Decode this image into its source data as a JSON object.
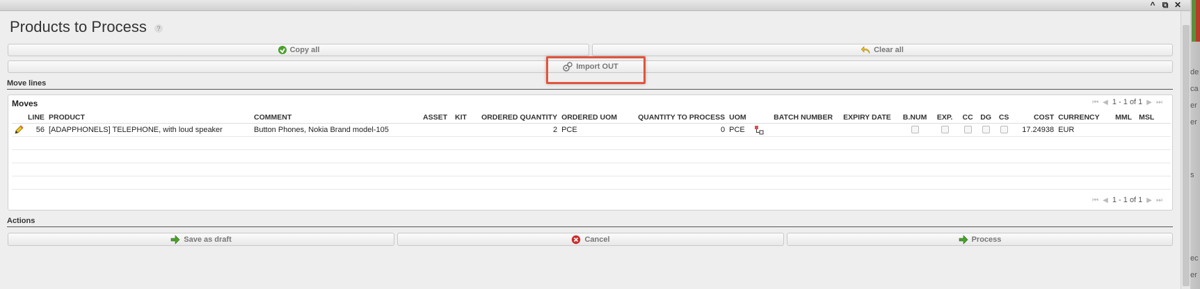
{
  "window": {
    "controls": [
      {
        "name": "minimize",
        "glyph": "^"
      },
      {
        "name": "popout",
        "glyph": "⧉"
      },
      {
        "name": "close",
        "glyph": "✕"
      }
    ]
  },
  "page": {
    "title": "Products to Process",
    "help_glyph": "?"
  },
  "toolbar": {
    "copy_all_label": "Copy all",
    "clear_all_label": "Clear all",
    "import_out_label": "Import OUT"
  },
  "sections": {
    "move_lines": "Move lines",
    "actions": "Actions"
  },
  "grid": {
    "title": "Moves",
    "pager_info": "1 - 1 of 1",
    "columns": {
      "line": "LINE",
      "product": "PRODUCT",
      "comment": "COMMENT",
      "asset": "ASSET",
      "kit": "KIT",
      "ordered_quantity": "ORDERED QUANTITY",
      "ordered_uom": "ORDERED UOM",
      "quantity_to_process": "QUANTITY TO PROCESS",
      "uom": "UOM",
      "batch_number": "BATCH NUMBER",
      "expiry_date": "EXPIRY DATE",
      "bnum": "B.NUM",
      "exp": "EXP.",
      "cc": "CC",
      "dg": "DG",
      "cs": "CS",
      "cost": "COST",
      "currency": "CURRENCY",
      "mml": "MML",
      "msl": "MSL"
    },
    "rows": [
      {
        "line": "56",
        "product": "[ADAPPHONELS] TELEPHONE, with loud speaker",
        "comment": "Button Phones, Nokia Brand model-105",
        "asset": "",
        "kit": "",
        "ordered_quantity": "2",
        "ordered_uom": "PCE",
        "quantity_to_process": "0",
        "uom": "PCE",
        "batch_number": "",
        "expiry_date": "",
        "cost": "17.24938",
        "currency": "EUR",
        "mml": "",
        "msl": ""
      }
    ]
  },
  "actions": {
    "save_draft_label": "Save as draft",
    "cancel_label": "Cancel",
    "process_label": "Process"
  },
  "side_fragments": [
    "de",
    "ca",
    "er",
    "er",
    "s",
    "ec",
    "er"
  ],
  "colors": {
    "highlight_border": "#e1543d",
    "green_icon": "#4aa02c",
    "yellow_icon": "#e8b923",
    "cancel_red": "#c9302c"
  }
}
